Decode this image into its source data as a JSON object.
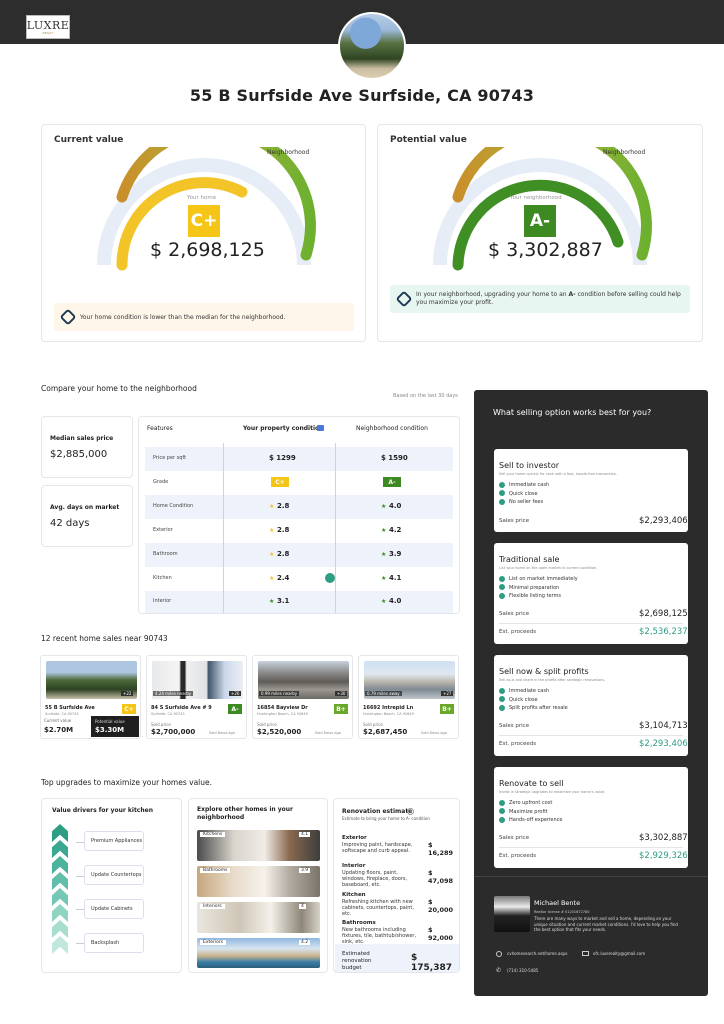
{
  "brand": {
    "logo_main": "LUXRE",
    "logo_sub": "REALTY"
  },
  "address": "55 B Surfside Ave Surfside, CA 90743",
  "current": {
    "title": "Current value",
    "neighborhood_label": "Neighborhood",
    "home_label": "Your home",
    "grade": "C+",
    "value": "$ 2,698,125",
    "note": "Your home condition is lower than the median for the neighborhood."
  },
  "potential": {
    "title": "Potential value",
    "neighborhood_label": "Neighborhood",
    "home_label": "Your neighborhood",
    "grade": "A-",
    "value": "$ 3,302,887",
    "note_pre": "In your neighborhood, upgrading your home to an ",
    "note_bold": "A-",
    "note_post": " condition before selling could help you maximize your profit."
  },
  "compare": {
    "title": "Compare your home to the neighborhood",
    "based_on": "Based on the last 30 days",
    "median_label": "Median sales price",
    "median_value": "$2,885,000",
    "days_label": "Avg. days on market",
    "days_value": "42 days",
    "col_features": "Features",
    "col_property": "Your property condition",
    "col_neighborhood": "Neighborhood condition",
    "rows": [
      {
        "feature": "Price per sqft",
        "yours": "$ 1299",
        "theirs": "$ 1590"
      },
      {
        "feature": "Grade",
        "yours": "C+",
        "theirs": "A-"
      },
      {
        "feature": "Home Condition",
        "yours": "2.8",
        "theirs": "4.0"
      },
      {
        "feature": "Exterior",
        "yours": "2.8",
        "theirs": "4.2"
      },
      {
        "feature": "Bathroom",
        "yours": "2.8",
        "theirs": "3.9"
      },
      {
        "feature": "Kitchen",
        "yours": "2.4",
        "theirs": "4.1"
      },
      {
        "feature": "Interior",
        "yours": "3.1",
        "theirs": "4.0"
      }
    ]
  },
  "recent": {
    "title": "12 recent home sales near 90743",
    "homes": [
      {
        "addr": "55 B Surfside Ave",
        "city": "Surfside, CA 90743",
        "grade": "C+",
        "cur_label": "Current value",
        "cur_value": "$2.70M",
        "pot_label": "Potential value",
        "pot_value": "$3.30M",
        "photos": "+22"
      },
      {
        "addr": "84 S Surfside Ave # 9",
        "city": "Surfside, CA 90743",
        "grade": "A-",
        "price_label": "Sold price",
        "price": "$2,700,000",
        "sold": "Sold 8mos ago",
        "tag": "4.24 miles nearby",
        "photos": "+26"
      },
      {
        "addr": "16854 Bayview Dr",
        "city": "Huntington Beach, CA 92649",
        "grade": "B+",
        "price_label": "Sold price",
        "price": "$2,520,000",
        "sold": "Sold 8mos ago",
        "tag": "0.99 miles nearby",
        "photos": "+30"
      },
      {
        "addr": "16692 Intrepid Ln",
        "city": "Huntington Beach, CA 92649",
        "grade": "B+",
        "price_label": "Sold price",
        "price": "$2,687,450",
        "sold": "Sold 8mos ago",
        "tag": "0.79 miles away",
        "photos": "+27"
      }
    ]
  },
  "upgrades": {
    "title": "Top upgrades to maximize your homes value.",
    "drivers_title": "Value drivers for your kitchen",
    "drivers": [
      "Premium Appliances",
      "Update Countertops",
      "Update Cabinets",
      "Backsplash"
    ],
    "explore_title": "Explore other homes in your neighborhood",
    "explore": [
      {
        "label": "Kitchens",
        "score": "4.1"
      },
      {
        "label": "Bathrooms",
        "score": "3.9"
      },
      {
        "label": "Interiors",
        "score": "4"
      },
      {
        "label": "Exteriors",
        "score": "4.2"
      }
    ],
    "renovation_title": "Renovation estimate",
    "renovation_sub": "Estimate to bring your home to A- condition",
    "renovation": [
      {
        "name": "Exterior",
        "desc": "Improving paint, hardscape, softscape and curb appeal.",
        "cost": "$ 16,289"
      },
      {
        "name": "Interior",
        "desc": "Updating floors, paint, windows, fireplace, doors, baseboard, etc.",
        "cost": "$ 47,098"
      },
      {
        "name": "Kitchen",
        "desc": "Refreshing kitchen with new cabinets, countertops, paint, etc.",
        "cost": "$ 20,000"
      },
      {
        "name": "Bathrooms",
        "desc": "New bathrooms including fixtures, tile, bathtub/shower, sink, etc.",
        "cost": "$ 92,000"
      }
    ],
    "budget_label": "Estimated renovation budget",
    "budget_value": "$ 175,387"
  },
  "selling": {
    "title": "What selling option works best for you?",
    "options": [
      {
        "name": "Sell to investor",
        "desc": "Sell your home quickly for cash with a fast, hassle-free transaction.",
        "items": [
          "Immediate cash",
          "Quick close",
          "No seller fees"
        ],
        "price_label": "Sales price",
        "price": "$2,293,406"
      },
      {
        "name": "Traditional sale",
        "desc": "List your home on the open market in current condition.",
        "items": [
          "List on market immediately",
          "Minimal preparation",
          "Flexible listing terms"
        ],
        "price_label": "Sales price",
        "price": "$2,698,125",
        "proceeds_label": "Est. proceeds",
        "proceeds": "$2,536,237"
      },
      {
        "name": "Sell now & split profits",
        "desc": "Sell as-is and share in the profits after strategic renovations.",
        "items": [
          "Immediate cash",
          "Quick close",
          "Split profits after resale"
        ],
        "price_label": "Sales price",
        "price": "$3,104,713",
        "proceeds_label": "Est. proceeds",
        "proceeds": "$2,293,406"
      },
      {
        "name": "Renovate to sell",
        "desc": "Invest in strategic upgrades to maximize your home's value.",
        "items": [
          "Zero upfront cost",
          "Maximize profit",
          "Hands-off experience"
        ],
        "price_label": "Sales price",
        "price": "$3,302,887",
        "proceeds_label": "Est. proceeds",
        "proceeds": "$2,929,326"
      }
    ],
    "agent": {
      "name": "Michael Bente",
      "license": "Realtor license # 01201672780",
      "bio": "There are many ways to market and sell a home, depending on your unique situation and current market conditions. I'd love to help you find the best option that fits your needs.",
      "website": "cvhomesearch.net/home.aspx",
      "email": "ofc.luxerealty@gmail.com",
      "phone": "(714) 310-5485"
    }
  },
  "colors": {
    "grade_c": "#f5c518",
    "grade_a": "#3c8a21",
    "teal": "#2d9d84",
    "dark": "#2b2b2b"
  }
}
